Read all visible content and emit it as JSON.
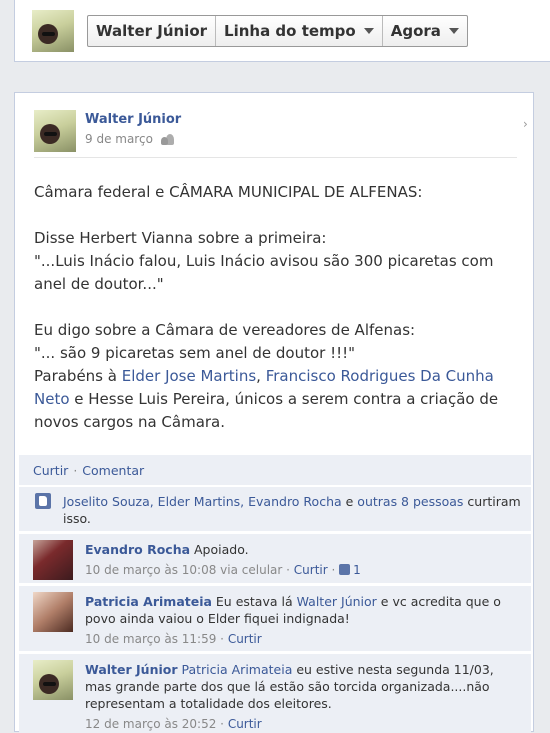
{
  "header": {
    "profile_button": "Walter Júnior",
    "timeline_button": "Linha do tempo",
    "now_button": "Agora"
  },
  "post": {
    "author": "Walter Júnior",
    "date": "9 de março",
    "lines": {
      "l1": "Câmara federal e CÂMARA MUNICIPAL DE ALFENAS:",
      "l2": "Disse Herbert Vianna sobre a primeira:",
      "l3": "\"...Luis Inácio falou, Luis Inácio avisou são 300 picaretas com anel de doutor...\"",
      "l4": "Eu digo sobre a Câmara de vereadores de Alfenas:",
      "l5": "\"... são 9 picaretas sem anel de doutor !!!\"",
      "l6_prefix": "Parabéns à ",
      "l6_link1": "Elder Jose Martins",
      "l6_comma": ", ",
      "l6_link2": "Francisco Rodrigues Da Cunha Neto",
      "l6_suffix": " e Hesse Luis Pereira, únicos a serem contra a criação de novos cargos na Câmara."
    }
  },
  "actions": {
    "like": "Curtir",
    "separator": "·",
    "comment": "Comentar"
  },
  "likes": {
    "names": "Joselito Souza, Elder Martins, Evandro Rocha",
    "middle": " e ",
    "others": "outras 8 pessoas",
    "end": " curtiram isso."
  },
  "comments": [
    {
      "name": "Evandro Rocha",
      "text": " Apoiado.",
      "meta": "10 de março às 10:08 via celular · ",
      "like": "Curtir",
      "sep": " · ",
      "likes_count": "1"
    },
    {
      "name": "Patricia Arimateia",
      "text_before": " Eu estava lá ",
      "mention": "Walter Júnior",
      "text_after": " e vc acredita que o povo ainda vaiou o Elder fiquei indignada!",
      "meta": "10 de março às 11:59 · ",
      "like": "Curtir"
    },
    {
      "name": "Walter Júnior",
      "mention": " Patricia Arimateia",
      "text_after": " eu estive nesta segunda 11/03, mas grande parte dos que lá estão são torcida organizada....não representam a totalidade dos eleitores.",
      "meta": "12 de março às 20:52 · ",
      "like": "Curtir"
    }
  ]
}
